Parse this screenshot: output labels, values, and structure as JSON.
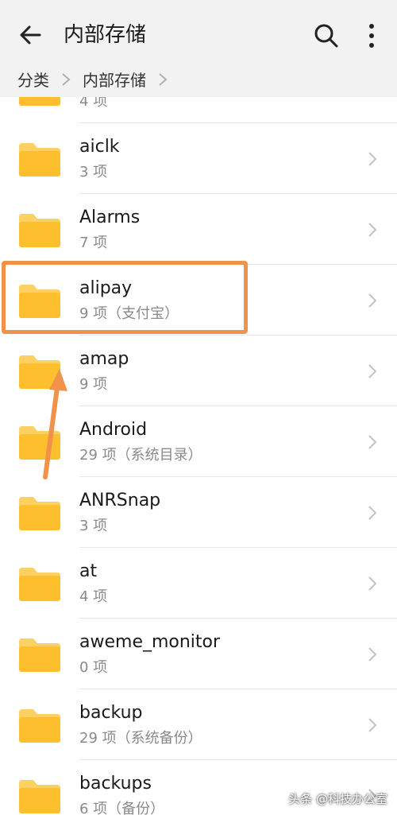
{
  "appbar": {
    "title": "内部存储",
    "back_icon": "arrow-left-icon",
    "search_icon": "search-icon",
    "more_icon": "more-vertical-icon"
  },
  "breadcrumb": {
    "items": [
      "分类",
      "内部存储"
    ]
  },
  "folders": [
    {
      "name": "",
      "meta": "4 项"
    },
    {
      "name": "aiclk",
      "meta": "3 项"
    },
    {
      "name": "Alarms",
      "meta": "7 项"
    },
    {
      "name": "alipay",
      "meta": "9 项（支付宝）"
    },
    {
      "name": "amap",
      "meta": "9 项"
    },
    {
      "name": "Android",
      "meta": "29 项（系统目录）"
    },
    {
      "name": "ANRSnap",
      "meta": "3 项"
    },
    {
      "name": "at",
      "meta": "4 项"
    },
    {
      "name": "aweme_monitor",
      "meta": "0 项"
    },
    {
      "name": "backup",
      "meta": "29 项（系统备份）"
    },
    {
      "name": "backups",
      "meta": "6 项（备份）"
    }
  ],
  "watermark": "头条 @科技办公室",
  "colors": {
    "folder": "#fdbf2d",
    "folder_tab": "#fdd064",
    "highlight": "#f0924a"
  }
}
